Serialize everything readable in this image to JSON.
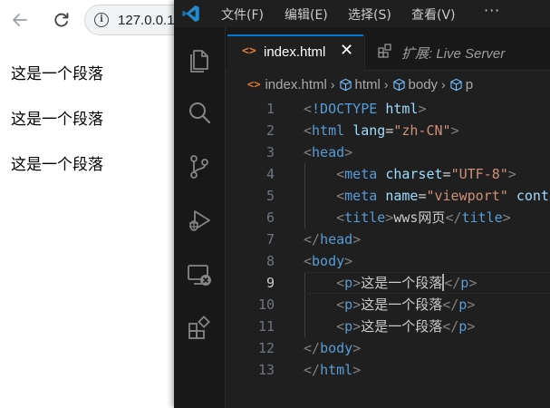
{
  "browser": {
    "url": "127.0.0.1",
    "paragraphs": [
      "这是一个段落",
      "这是一个段落",
      "这是一个段落"
    ]
  },
  "vscode": {
    "menu": {
      "file": "文件(F)",
      "edit": "编辑(E)",
      "select": "选择(S)",
      "view": "查看(V)",
      "more": "···"
    },
    "tabs": {
      "active": {
        "icon": "<>",
        "label": "index.html",
        "close": "✕"
      },
      "preview": {
        "label": "扩展: Live Server"
      }
    },
    "breadcrumb": {
      "file": "index.html",
      "items": [
        "html",
        "body",
        "p"
      ]
    },
    "editor": {
      "active_line": 9,
      "lines": [
        [
          [
            "brk",
            "<"
          ],
          [
            "tag",
            "!DOCTYPE "
          ],
          [
            "attr",
            "html"
          ],
          [
            "brk",
            ">"
          ]
        ],
        [
          [
            "brk",
            "<"
          ],
          [
            "tag",
            "html "
          ],
          [
            "attr",
            "lang"
          ],
          [
            "txt",
            "="
          ],
          [
            "str",
            "\"zh-CN\""
          ],
          [
            "brk",
            ">"
          ]
        ],
        [
          [
            "brk",
            "<"
          ],
          [
            "tag",
            "head"
          ],
          [
            "brk",
            ">"
          ]
        ],
        [
          [
            "txt",
            "    "
          ],
          [
            "brk",
            "<"
          ],
          [
            "tag",
            "meta "
          ],
          [
            "attr",
            "charset"
          ],
          [
            "txt",
            "="
          ],
          [
            "str",
            "\"UTF-8\""
          ],
          [
            "brk",
            ">"
          ]
        ],
        [
          [
            "txt",
            "    "
          ],
          [
            "brk",
            "<"
          ],
          [
            "tag",
            "meta "
          ],
          [
            "attr",
            "name"
          ],
          [
            "txt",
            "="
          ],
          [
            "str",
            "\"viewport\""
          ],
          [
            "txt",
            " "
          ],
          [
            "attr",
            "content"
          ]
        ],
        [
          [
            "txt",
            "    "
          ],
          [
            "brk",
            "<"
          ],
          [
            "tag",
            "title"
          ],
          [
            "brk",
            ">"
          ],
          [
            "txt",
            "wws网页"
          ],
          [
            "brk",
            "</"
          ],
          [
            "tag",
            "title"
          ],
          [
            "brk",
            ">"
          ]
        ],
        [
          [
            "brk",
            "</"
          ],
          [
            "tag",
            "head"
          ],
          [
            "brk",
            ">"
          ]
        ],
        [
          [
            "brk",
            "<"
          ],
          [
            "tag",
            "body"
          ],
          [
            "brk",
            ">"
          ]
        ],
        [
          [
            "txt",
            "    "
          ],
          [
            "brk",
            "<"
          ],
          [
            "tag",
            "p"
          ],
          [
            "brk",
            ">"
          ],
          [
            "txt",
            "这是一个段落"
          ],
          [
            "cursor",
            ""
          ],
          [
            "brk",
            "</"
          ],
          [
            "tag",
            "p"
          ],
          [
            "brk",
            ">"
          ]
        ],
        [
          [
            "txt",
            "    "
          ],
          [
            "brk",
            "<"
          ],
          [
            "tag",
            "p"
          ],
          [
            "brk",
            ">"
          ],
          [
            "txt",
            "这是一个段落"
          ],
          [
            "brk",
            "</"
          ],
          [
            "tag",
            "p"
          ],
          [
            "brk",
            ">"
          ]
        ],
        [
          [
            "txt",
            "    "
          ],
          [
            "brk",
            "<"
          ],
          [
            "tag",
            "p"
          ],
          [
            "brk",
            ">"
          ],
          [
            "txt",
            "这是一个段落"
          ],
          [
            "brk",
            "</"
          ],
          [
            "tag",
            "p"
          ],
          [
            "brk",
            ">"
          ]
        ],
        [
          [
            "brk",
            "</"
          ],
          [
            "tag",
            "body"
          ],
          [
            "brk",
            ">"
          ]
        ],
        [
          [
            "brk",
            "</"
          ],
          [
            "tag",
            "html"
          ],
          [
            "brk",
            ">"
          ]
        ]
      ]
    },
    "colors": {
      "accent": "#0078d4",
      "tag": "#569cd6",
      "attribute": "#9cdcfe",
      "string": "#ce9178",
      "bracket": "#808080",
      "text": "#cccccc"
    },
    "icons": {
      "activity": [
        "files-icon",
        "search-icon",
        "source-control-icon",
        "run-debug-icon",
        "remote-explorer-icon",
        "extensions-icon"
      ]
    }
  }
}
